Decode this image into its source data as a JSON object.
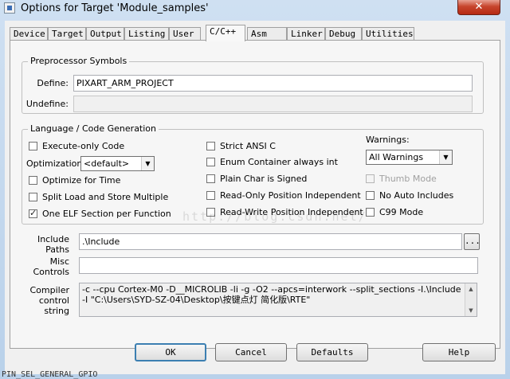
{
  "window": {
    "title": "Options for Target 'Module_samples'",
    "close_glyph": "✕"
  },
  "tabs": [
    {
      "label": "Device"
    },
    {
      "label": "Target"
    },
    {
      "label": "Output"
    },
    {
      "label": "Listing"
    },
    {
      "label": "User"
    },
    {
      "label": "C/C++",
      "active": true
    },
    {
      "label": "Asm"
    },
    {
      "label": "Linker"
    },
    {
      "label": "Debug"
    },
    {
      "label": "Utilities"
    }
  ],
  "preprocessor": {
    "group_label": "Preprocessor Symbols",
    "define_label": "Define:",
    "define_value": "PIXART_ARM_PROJECT",
    "undefine_label": "Undefine:",
    "undefine_value": ""
  },
  "language": {
    "group_label": "Language / Code Generation",
    "execute_only": {
      "label": "Execute-only Code",
      "checked": false
    },
    "optimization_label": "Optimization:",
    "optimization_value": "<default>",
    "optimize_for_time": {
      "label": "Optimize for Time",
      "checked": false
    },
    "split_load_store": {
      "label": "Split Load and Store Multiple",
      "checked": false
    },
    "one_elf_section": {
      "label": "One ELF Section per Function",
      "checked": true
    },
    "strict_ansi": {
      "label": "Strict ANSI C",
      "checked": false
    },
    "enum_container": {
      "label": "Enum Container always int",
      "checked": false
    },
    "plain_char_signed": {
      "label": "Plain Char is Signed",
      "checked": false
    },
    "ro_position_independent": {
      "label": "Read-Only Position Independent",
      "checked": false
    },
    "rw_position_independent": {
      "label": "Read-Write Position Independent",
      "checked": false
    },
    "warnings_label": "Warnings:",
    "warnings_value": "All Warnings",
    "thumb_mode": {
      "label": "Thumb Mode",
      "checked": false,
      "disabled": true
    },
    "no_auto_includes": {
      "label": "No Auto Includes",
      "checked": false
    },
    "c99_mode": {
      "label": "C99 Mode",
      "checked": false
    }
  },
  "include_paths": {
    "label_line1": "Include",
    "label_line2": "Paths",
    "value": ".\\Include",
    "browse_label": "..."
  },
  "misc_controls": {
    "label_line1": "Misc",
    "label_line2": "Controls",
    "value": ""
  },
  "compiler_control": {
    "label_line1": "Compiler",
    "label_line2": "control",
    "label_line3": "string",
    "line1": "-c --cpu Cortex-M0 -D__MICROLIB -li -g -O2 --apcs=interwork --split_sections -I.\\Include",
    "line2": "-I \"C:\\Users\\SYD-SZ-04\\Desktop\\按键点灯 简化版\\RTE\""
  },
  "buttons": {
    "ok": "OK",
    "cancel": "Cancel",
    "defaults": "Defaults",
    "help": "Help"
  },
  "watermark": "http://blog.csdn.net/",
  "background_strip": "PIN_SEL_GENERAL_GPIO"
}
